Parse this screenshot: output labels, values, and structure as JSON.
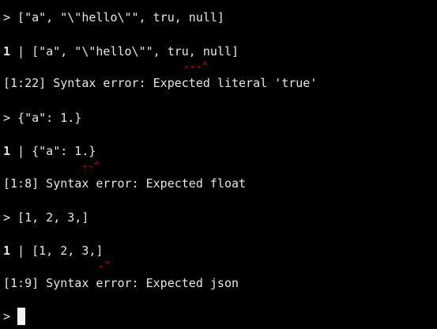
{
  "terminal": {
    "blocks": [
      {
        "prompt": "> [\"a\", \"\\\"hello\\\"\", tru, null]",
        "echo_line_number": "1",
        "echo_sep": " | ",
        "echo_text": "[\"a\", \"\\\"hello\\\"\", tru, null]",
        "marker": "---^",
        "error": "[1:22] Syntax error: Expected literal 'true'"
      },
      {
        "prompt": "> {\"a\": 1.}",
        "echo_line_number": "1",
        "echo_sep": " | ",
        "echo_text": "{\"a\": 1.}",
        "marker": "--^",
        "error": "[1:8] Syntax error: Expected float"
      },
      {
        "prompt": "> [1, 2, 3,]",
        "echo_line_number": "1",
        "echo_sep": " | ",
        "echo_text": "[1, 2, 3,]",
        "marker": "-^",
        "error": "[1:9] Syntax error: Expected json"
      }
    ],
    "current_prompt": ">",
    "colors": {
      "background": "#000000",
      "text": "#e6e6e6",
      "error_marker": "#d40000",
      "cursor": "#f2f2f2"
    }
  }
}
